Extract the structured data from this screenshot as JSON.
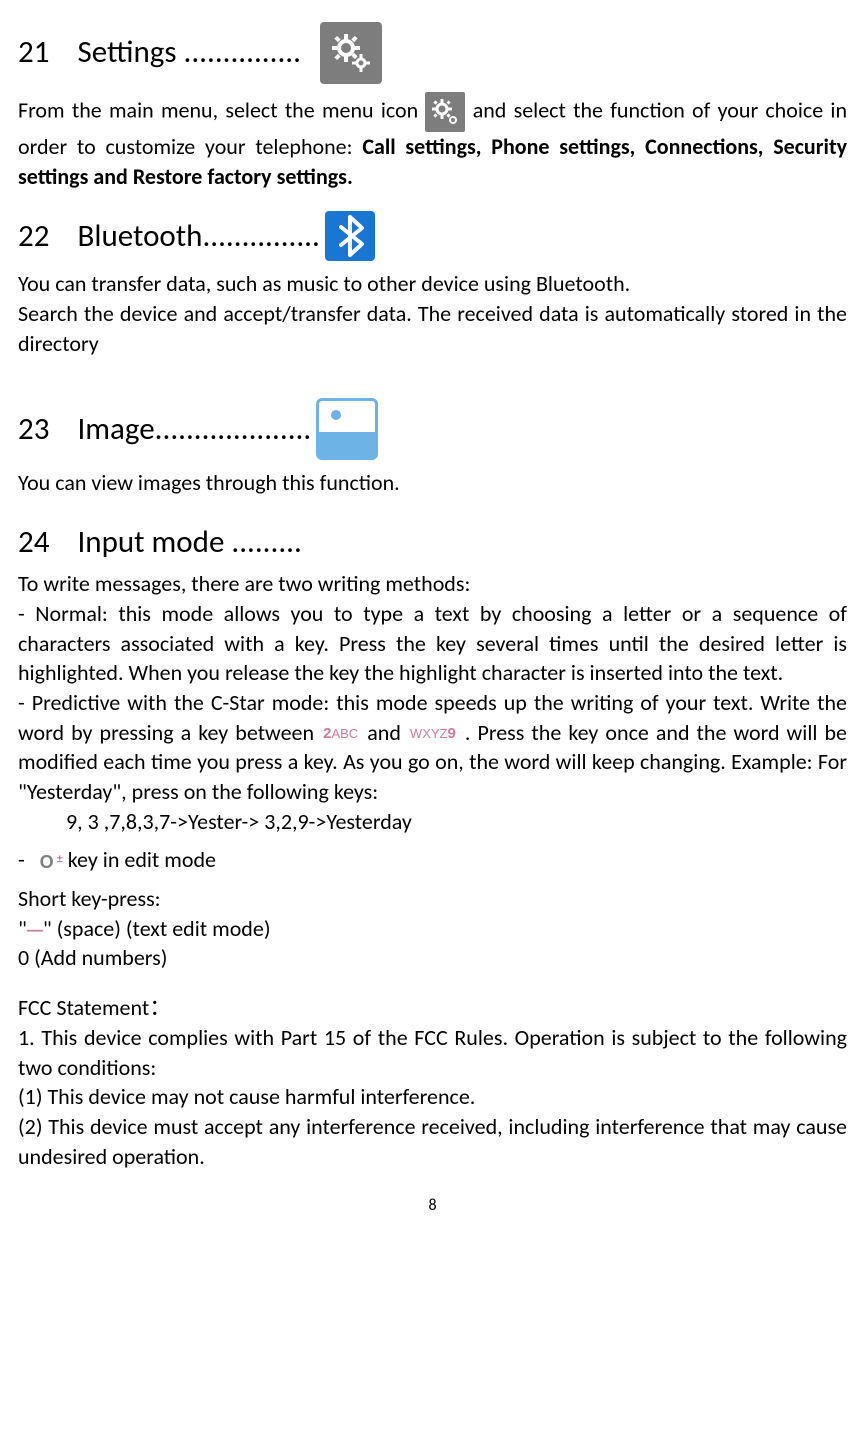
{
  "headings": {
    "h21_num": "21",
    "h21_title": "Settings ...............",
    "h22_num": "22",
    "h22_title": "Bluetooth...............",
    "h23_num": "23",
    "h23_title": "Image....................",
    "h24_num": "24",
    "h24_title": "Input mode ........."
  },
  "settings": {
    "p1_a": "From the main menu, select the menu icon",
    "p1_b": "and select the function of your choice in order to customize your telephone:",
    "bold": "Call settings, Phone settings, Connections, Security settings and Restore factory settings."
  },
  "bluetooth": {
    "p1": "You can transfer data, such as music to other device using Bluetooth.",
    "p2": "Search the device and accept/transfer data. The received data is automatically stored in the directory"
  },
  "image": {
    "p1": "You can view images through this function."
  },
  "input": {
    "intro": "To write messages, there are two writing methods:",
    "normal": "- Normal: this mode allows you to type a text by choosing a letter or a sequence of characters associated with a key. Press the key several times until the desired letter is highlighted. When you release the key the highlight character is inserted into the text.",
    "pred_a": "- Predictive with the C-Star mode: this mode speeds up the writing of your text. Write the word by pressing a key between",
    "key2": "2",
    "key2_sub": "ABC",
    "pred_and": "and",
    "key9_sub": "WXYZ",
    "key9": "9",
    "pred_b": ". Press the key once and the word will be modified each time you press a key. As you go on, the word will keep changing. Example: For \"Yesterday\", press on the following keys:",
    "example": "9, 3 ,7,8,3,7->Yester-> 3,2,9->Yesterday",
    "dash": "-",
    "keyline": " key in edit mode",
    "short_head": "Short key-press:",
    "short1_a": "\"",
    "short1_b": "\" (space) (text edit mode)",
    "short2": "0 (Add numbers)"
  },
  "fcc": {
    "head": "FCC Statement：",
    "p1": "1. This device complies with Part 15 of the    FCC Rules. Operation is subject to the following two conditions:",
    "p2": "(1) This device may not cause harmful interference.",
    "p3": "(2) This device must accept any interference received, including interference that may cause undesired operation."
  },
  "page_number": "8"
}
